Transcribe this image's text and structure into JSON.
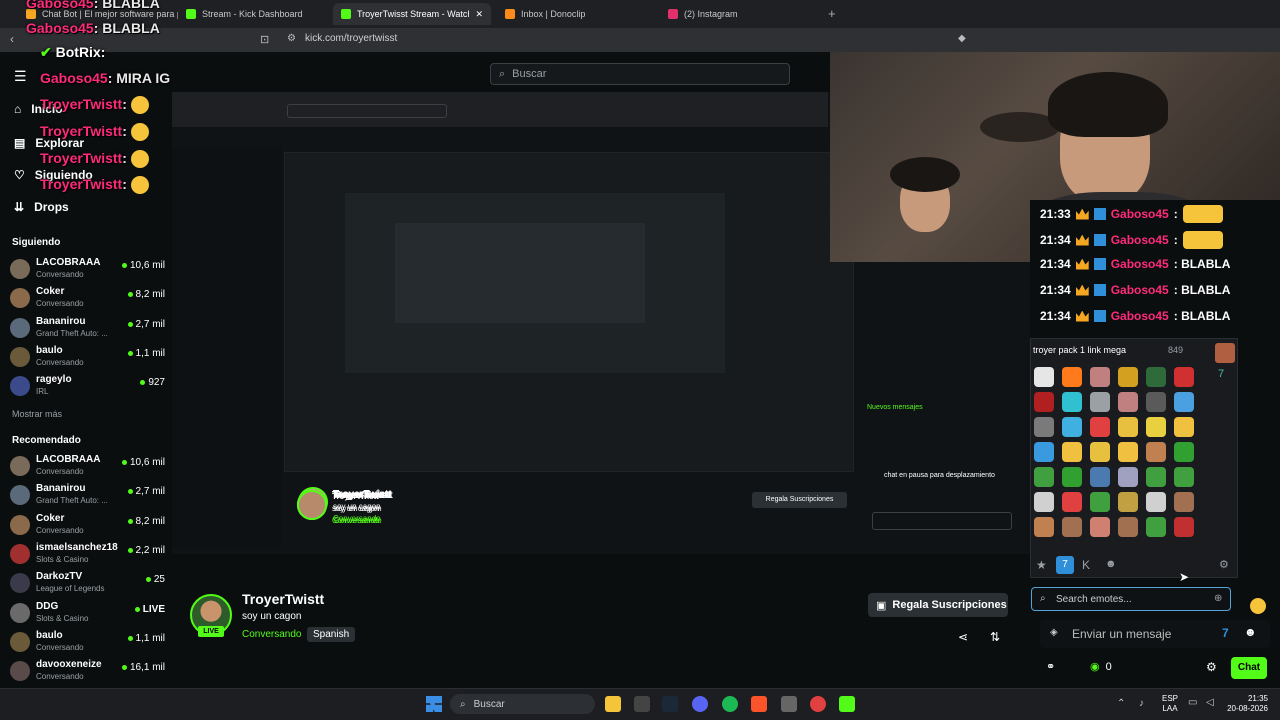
{
  "browser": {
    "tabs": [
      {
        "label": "Chat Bot | El mejor software para pc...",
        "color": "#f5a623"
      },
      {
        "label": "Stream - Kick Dashboard",
        "color": "#53fc18"
      },
      {
        "label": "TroyerTwisst Stream - Watch Live...",
        "color": "#53fc18"
      },
      {
        "label": "Inbox | Donoclip",
        "color": "#ff8c1a"
      },
      {
        "label": "(2) Instagram",
        "color": "#e1306c"
      }
    ],
    "url": "kick.com/troyertwisst"
  },
  "search": {
    "placeholder": "Buscar"
  },
  "nav": {
    "inicio": "Inicio",
    "explorar": "Explorar",
    "siguiendo": "Siguiendo",
    "drops": "Drops"
  },
  "sidebar": {
    "following_title": "Siguiendo",
    "following": [
      {
        "name": "LACOBRAAA",
        "game": "Conversando",
        "viewers": "10,6 mil",
        "color": "#7a6a5a"
      },
      {
        "name": "Coker",
        "game": "Conversando",
        "viewers": "8,2 mil",
        "color": "#8a6a4a"
      },
      {
        "name": "Bananirou",
        "game": "Grand Theft Auto: ...",
        "viewers": "2,7 mil",
        "color": "#5a6a7a"
      },
      {
        "name": "baulo",
        "game": "Conversando",
        "viewers": "1,1 mil",
        "color": "#6a5a3a"
      },
      {
        "name": "rageylo",
        "game": "IRL",
        "viewers": "927",
        "color": "#3a4a8a"
      }
    ],
    "show_more": "Mostrar más",
    "recommended_title": "Recomendado",
    "recommended": [
      {
        "name": "LACOBRAAA",
        "game": "Conversando",
        "viewers": "10,6 mil",
        "color": "#7a6a5a"
      },
      {
        "name": "Bananirou",
        "game": "Grand Theft Auto: ...",
        "viewers": "2,7 mil",
        "color": "#5a6a7a"
      },
      {
        "name": "Coker",
        "game": "Conversando",
        "viewers": "8,2 mil",
        "color": "#8a6a4a"
      },
      {
        "name": "ismaelsanchez18",
        "game": "Slots & Casino",
        "viewers": "2,2 mil",
        "color": "#a03030"
      },
      {
        "name": "DarkozTV",
        "game": "League of Legends",
        "viewers": "25",
        "color": "#3a3a4a"
      },
      {
        "name": "DDG",
        "game": "Slots & Casino",
        "viewers": "LIVE",
        "color": "#6a6a6a"
      },
      {
        "name": "baulo",
        "game": "Conversando",
        "viewers": "1,1 mil",
        "color": "#6a5a3a"
      },
      {
        "name": "davooxeneize",
        "game": "Conversando",
        "viewers": "16,1 mil",
        "color": "#5a4a4a"
      }
    ]
  },
  "overlay_chat": [
    {
      "user": "Gaboso45",
      "text": ": BLABLA"
    },
    {
      "user": "Gaboso45",
      "text": ": BLABLA"
    },
    {
      "user": "BotRix",
      "text": ""
    },
    {
      "user": "Gaboso45",
      "text": ": MIRA IG"
    },
    {
      "user": "TroyerTwistt",
      "text": ""
    },
    {
      "user": "TroyerTwistt",
      "text": ""
    },
    {
      "user": "TroyerTwistt",
      "text": ""
    },
    {
      "user": "TroyerTwistt",
      "text": ""
    }
  ],
  "chat": [
    {
      "time": "21:33",
      "user": "Gaboso45",
      "text": ""
    },
    {
      "time": "21:34",
      "user": "Gaboso45",
      "text": ""
    },
    {
      "time": "21:34",
      "user": "Gaboso45",
      "text": ": BLABLA"
    },
    {
      "time": "21:34",
      "user": "Gaboso45",
      "text": ": BLABLA"
    },
    {
      "time": "21:34",
      "user": "Gaboso45",
      "text": ": BLABLA"
    }
  ],
  "emote_picker": {
    "pack_name": "troyer pack 1 link mega",
    "count": "849",
    "search_placeholder": "Search emotes...",
    "emote_colors": [
      "#e6e6e6",
      "#ff7a1a",
      "#c08080",
      "#d4a020",
      "#2e6a3a",
      "#d03030",
      "#b02020",
      "#30c0d0",
      "#9aa0a4",
      "#c08080",
      "#5a5a5a",
      "#4aa0e0",
      "#7a7a7a",
      "#40b0e0",
      "#e04040",
      "#e8c040",
      "#e8d040",
      "#f0c040",
      "#3a9ae0",
      "#f0c040",
      "#e8c040",
      "#f0c040",
      "#c08050",
      "#30a030",
      "#40a040",
      "#30a030",
      "#4a7ab0",
      "#a0a0c0",
      "#40a040",
      "#40a040",
      "#d0d0d0",
      "#e04040",
      "#40a040",
      "#c0a040",
      "#d0d0d0",
      "#a07050",
      "#c08050",
      "#a07050",
      "#d08070",
      "#a07050",
      "#40a040",
      "#c03030"
    ]
  },
  "chat_input": {
    "placeholder": "Enviar un mensaje",
    "chat_button": "Chat",
    "points": "0"
  },
  "streamer": {
    "name": "TroyerTwistt",
    "title": "soy un cagon",
    "category": "Conversando",
    "language": "Spanish",
    "live": "LIVE",
    "subs_button": "Regala Suscripciones"
  },
  "taskbar": {
    "search": "Buscar",
    "lang": "ESP",
    "lang2": "LAA",
    "time": "21:35",
    "date": "20-08-2026"
  },
  "nested_label": {
    "header": "Nuevos mensajes",
    "paused": "chat en pausa para desplazamiento"
  }
}
